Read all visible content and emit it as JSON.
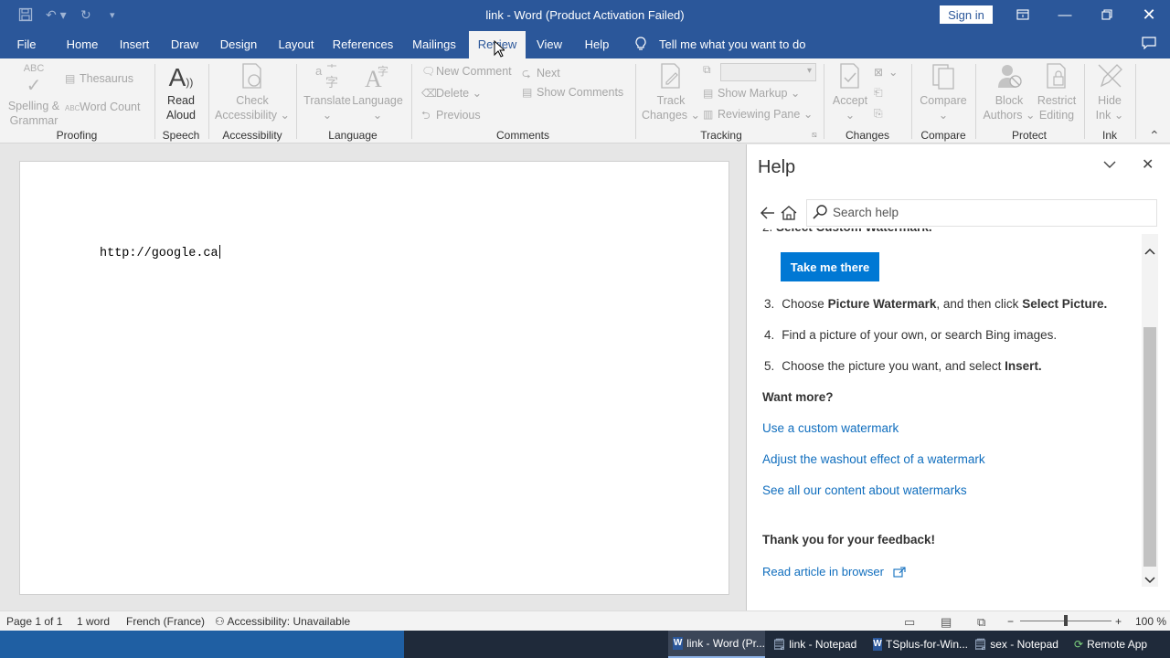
{
  "window": {
    "title": "link  -  Word (Product Activation Failed)",
    "sign_in": "Sign in"
  },
  "qat": {
    "save_icon": "save-icon",
    "undo_icon": "undo-icon",
    "redo_icon": "redo-icon",
    "customize_icon": "chevron-down-icon"
  },
  "tabs": [
    "File",
    "Home",
    "Insert",
    "Draw",
    "Design",
    "Layout",
    "References",
    "Mailings",
    "Review",
    "View",
    "Help"
  ],
  "active_tab": "Review",
  "tell_me": "Tell me what you want to do",
  "ribbon": {
    "proofing": {
      "spelling": "Spelling &",
      "grammar": "Grammar",
      "thesaurus": "Thesaurus",
      "word_count": "Word Count",
      "label": "Proofing"
    },
    "speech": {
      "read": "Read",
      "aloud": "Aloud",
      "label": "Speech"
    },
    "accessibility": {
      "check": "Check",
      "accessibility": "Accessibility",
      "label": "Accessibility"
    },
    "language": {
      "translate": "Translate",
      "language": "Language",
      "label": "Language"
    },
    "comments": {
      "new_comment": "New Comment",
      "delete": "Delete",
      "previous": "Previous",
      "next": "Next",
      "show_comments": "Show Comments",
      "label": "Comments"
    },
    "tracking": {
      "track": "Track",
      "changes": "Changes",
      "show_markup": "Show Markup",
      "reviewing_pane": "Reviewing Pane",
      "label": "Tracking"
    },
    "changes": {
      "accept": "Accept",
      "label": "Changes"
    },
    "compare": {
      "compare": "Compare",
      "label": "Compare"
    },
    "protect": {
      "block": "Block",
      "authors": "Authors",
      "restrict": "Restrict",
      "editing": "Editing",
      "label": "Protect"
    },
    "ink": {
      "hide": "Hide",
      "ink": "Ink",
      "label": "Ink"
    }
  },
  "document": {
    "text": "http://google.ca"
  },
  "help": {
    "title": "Help",
    "search_placeholder": "Search help",
    "take_me_there": "Take me there",
    "steps": [
      {
        "num": "3.",
        "parts": [
          "Choose ",
          "Picture Watermark",
          ", and then click ",
          "Select Picture."
        ]
      },
      {
        "num": "4.",
        "parts": [
          "Find a picture of your own, or search Bing images."
        ]
      },
      {
        "num": "5.",
        "parts": [
          "Choose the picture you want, and select ",
          "Insert."
        ]
      }
    ],
    "want_more": "Want more?",
    "links": [
      "Use a custom watermark",
      "Adjust the washout effect of a watermark",
      "See all our content about watermarks"
    ],
    "thanks": "Thank you for your feedback!",
    "read_in_browser": "Read article in browser"
  },
  "status": {
    "page": "Page 1 of 1",
    "words": "1 word",
    "language": "French (France)",
    "accessibility": "Accessibility: Unavailable",
    "zoom": "100 %"
  },
  "taskbar": [
    "link - Word (Pr...",
    "link - Notepad",
    "TSplus-for-Win...",
    "sex - Notepad",
    "Remote App"
  ],
  "colors": {
    "word_blue": "#2b579a",
    "link_blue": "#106ebe",
    "button_blue": "#0078d4"
  }
}
